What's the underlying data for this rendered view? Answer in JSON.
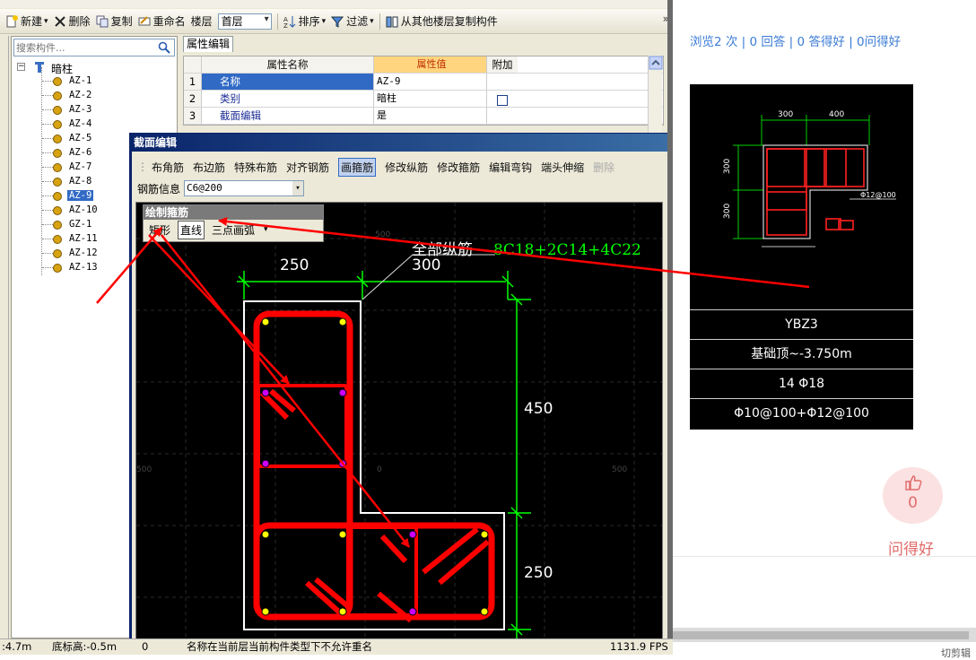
{
  "toolbar": {
    "new_label": "新建",
    "delete_label": "删除",
    "copy_label": "复制",
    "rename_label": "重命名",
    "floor_label": "楼层",
    "floor_value": "首层",
    "sort_label": "排序",
    "filter_label": "过滤",
    "copy_from_floor_label": "从其他楼层复制构件",
    "more_label": "»"
  },
  "left_panel": {
    "search_placeholder": "搜索构件...",
    "root_label": "暗柱",
    "items": [
      "AZ-1",
      "AZ-2",
      "AZ-3",
      "AZ-4",
      "AZ-5",
      "AZ-6",
      "AZ-7",
      "AZ-8",
      "AZ-9",
      "AZ-10",
      "GZ-1",
      "AZ-11",
      "AZ-12",
      "AZ-13"
    ],
    "selected_item": "AZ-9"
  },
  "property_panel": {
    "tab_label": "属性编辑",
    "headers": {
      "name": "属性名称",
      "value": "属性值",
      "extra": "附加"
    },
    "rows": [
      {
        "index": "1",
        "name": "名称",
        "value": "AZ-9",
        "extra": false
      },
      {
        "index": "2",
        "name": "类别",
        "value": "暗柱",
        "extra": true
      },
      {
        "index": "3",
        "name": "截面编辑",
        "value": "是",
        "extra": false
      }
    ]
  },
  "dialog": {
    "title": "截面编辑",
    "toolbar1": [
      "布角筋",
      "布边筋",
      "特殊布筋",
      "对齐钢筋",
      "画箍筋",
      "修改纵筋",
      "修改箍筋",
      "编辑弯钩",
      "端头伸缩",
      "删除"
    ],
    "active_tool": "画箍筋",
    "disabled_tool": "删除",
    "rebar_info_label": "钢筋信息",
    "rebar_info_value": "C6@200",
    "draw_panel": {
      "title": "绘制箍筋",
      "options": [
        "矩形",
        "直线",
        "三点画弧"
      ],
      "active_option": "直线"
    },
    "canvas": {
      "all_longitudinal_label": "全部纵筋",
      "all_longitudinal_value": "8C18+2C14+4C22",
      "dims": [
        "250",
        "300",
        "450",
        "250"
      ],
      "coord_labels": [
        "500",
        "500",
        "0",
        "500"
      ]
    }
  },
  "statusbar": {
    "left": ":4.7m",
    "base_height": "底标高:-0.5m",
    "count": "0",
    "message": "名称在当前层当前构件类型下不允许重名",
    "fps": "1131.9 FPS"
  },
  "webpage": {
    "stats": "浏览2 次 | 0 回答 | 0 答得好 | 0问得好",
    "drawing": {
      "dim_top_1": "300",
      "dim_top_2": "400",
      "dim_left_1": "300",
      "dim_left_2": "300",
      "stirrup_note": "Φ12@100",
      "name": "YBZ3",
      "range": "基础顶~-3.750m",
      "longitudinal": "14 Φ18",
      "stirrups": "Φ10@100+Φ12@100"
    },
    "like_count": "0",
    "like_label": "问得好",
    "footer": "切剪辑"
  },
  "colors": {
    "rebar_red": "#ff0000",
    "dim_green": "#00ff00",
    "selection_blue": "#316ac5",
    "link_blue": "#3a7bd5",
    "like_pink": "#e26a6a"
  }
}
